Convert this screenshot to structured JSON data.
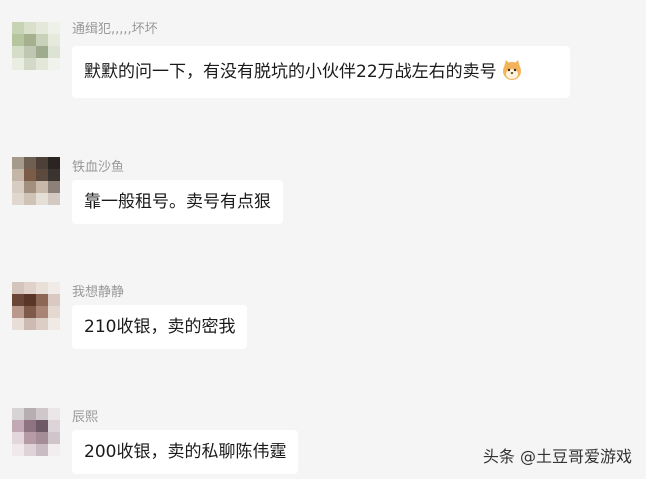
{
  "messages": [
    {
      "sender": "通缉犯,,,,,坏坏",
      "text": "默默的问一下，有没有脱坑的小伙伴22万战左右的卖号",
      "emoji": "shiba-dog-emoji"
    },
    {
      "sender": "铁血沙鱼",
      "text": "靠一般租号。卖号有点狠"
    },
    {
      "sender": "我想静静",
      "text": "210收银，卖的密我"
    },
    {
      "sender": "辰熙",
      "text": "200收银，卖的私聊陈伟霆"
    }
  ],
  "watermark": "头条 @土豆哥爱游戏",
  "colors": {
    "background": "#f5f5f5",
    "bubble": "#ffffff",
    "name": "#999999",
    "text": "#1a1a1a"
  }
}
